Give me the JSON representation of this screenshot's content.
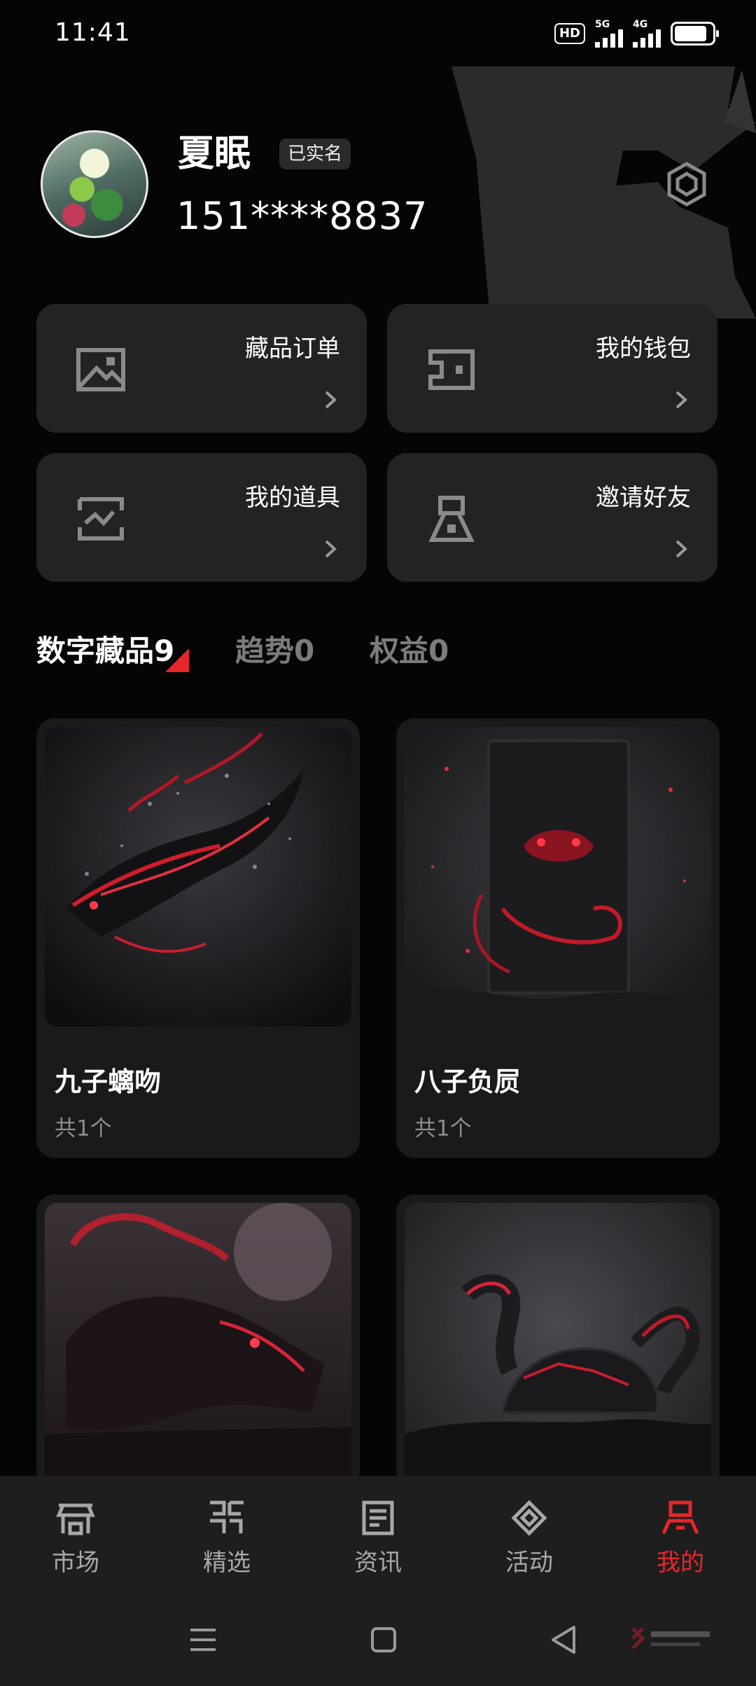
{
  "status_bar": {
    "time": "11:41",
    "hd_label": "HD",
    "network_1": "5G",
    "network_2": "4G"
  },
  "profile": {
    "name": "夏眠",
    "verified_badge": "已实名",
    "phone": "151****8837"
  },
  "quick_menu": [
    {
      "label": "藏品订单",
      "icon": "image-icon"
    },
    {
      "label": "我的钱包",
      "icon": "wallet-icon"
    },
    {
      "label": "我的道具",
      "icon": "props-icon"
    },
    {
      "label": "邀请好友",
      "icon": "invite-icon"
    }
  ],
  "tabs": [
    {
      "label": "数字藏品9",
      "active": true
    },
    {
      "label": "趋势0",
      "active": false
    },
    {
      "label": "权益0",
      "active": false
    }
  ],
  "collections": [
    {
      "name": "九子螭吻",
      "count": "共1个"
    },
    {
      "name": "八子负屃",
      "count": "共1个"
    },
    {
      "name": "",
      "count": ""
    },
    {
      "name": "",
      "count": ""
    }
  ],
  "bottom_nav": [
    {
      "label": "市场",
      "icon": "market-icon",
      "active": false
    },
    {
      "label": "精选",
      "icon": "featured-icon",
      "active": false
    },
    {
      "label": "资讯",
      "icon": "news-icon",
      "active": false
    },
    {
      "label": "活动",
      "icon": "activity-icon",
      "active": false
    },
    {
      "label": "我的",
      "icon": "profile-icon",
      "active": true
    }
  ],
  "colors": {
    "background": "#050505",
    "card": "#232323",
    "accent_red": "#e8262a",
    "muted_text": "#8d8d8d"
  }
}
